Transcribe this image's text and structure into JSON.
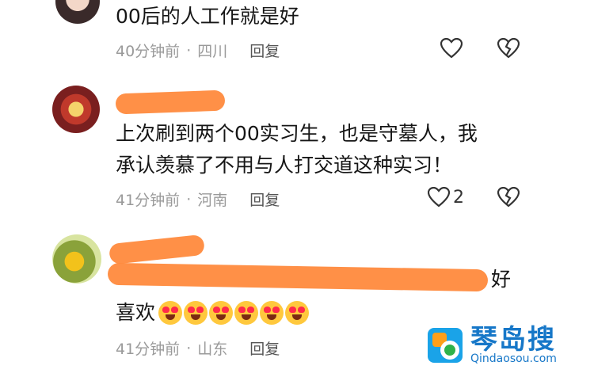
{
  "comments": [
    {
      "text": "00后的人工作就是好",
      "time": "40分钟前",
      "sep": "·",
      "location": "四川",
      "reply": "回复",
      "likes": ""
    },
    {
      "text_line1": "上次刷到两个00实习生，也是守墓人，我",
      "text_line2": "承认羡慕了不用与人打交道这种实习！",
      "time": "41分钟前",
      "sep": "·",
      "location": "河南",
      "reply": "回复",
      "likes": "2"
    },
    {
      "text_tail": "好",
      "text_line2": "喜欢",
      "emoji_count": 6,
      "time": "41分钟前",
      "sep": "·",
      "location": "山东",
      "reply": "回复"
    }
  ],
  "watermark": {
    "brand": "琴岛搜",
    "url": "Qindaosou.com"
  },
  "colors": {
    "redaction": "#ff8a3d",
    "meta_text": "#9a9a9a",
    "body_text": "#161616"
  }
}
